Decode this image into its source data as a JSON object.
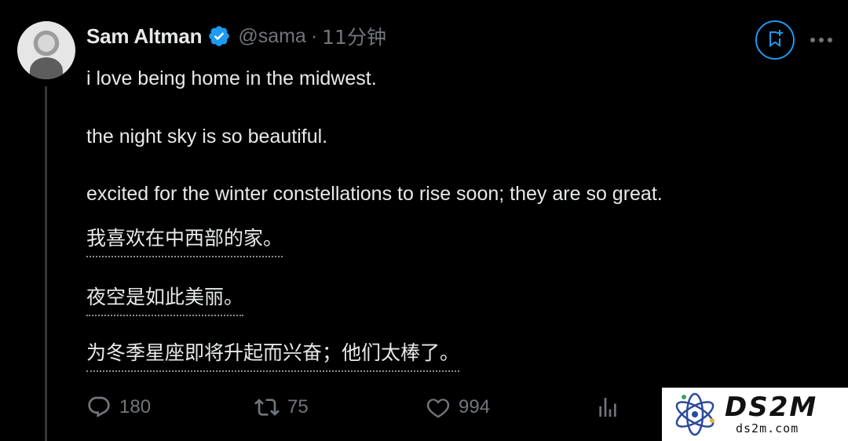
{
  "tweet": {
    "author_name": "Sam Altman",
    "handle": "@sama",
    "separator": "·",
    "time": "11分钟",
    "paragraphs_en": [
      "i love being home in the midwest.",
      "the night sky is so beautiful.",
      "excited for the winter constellations to rise soon; they are so great."
    ],
    "paragraphs_zh": [
      "我喜欢在中西部的家。",
      "夜空是如此美丽。",
      "为冬季星座即将升起而兴奋；他们太棒了。"
    ]
  },
  "actions": {
    "replies": "180",
    "retweets": "75",
    "likes": "994"
  },
  "icons": {
    "verified": "verified-badge-icon",
    "bookmark": "bookmark-add-icon",
    "more": "more-dots-icon",
    "reply": "reply-icon",
    "retweet": "retweet-icon",
    "like": "heart-icon",
    "views": "views-chart-icon"
  },
  "watermark": {
    "brand": "DS2M",
    "url": "ds2m.com"
  },
  "colors": {
    "background": "#000000",
    "text": "#e7e9ea",
    "muted": "#71767b",
    "accent": "#1d9bf0"
  }
}
